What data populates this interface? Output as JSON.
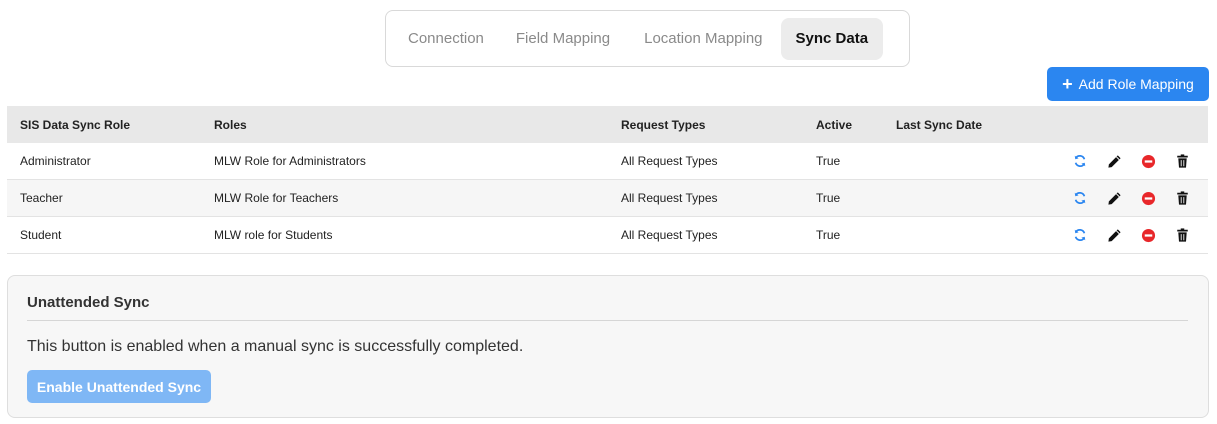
{
  "tabs": [
    {
      "label": "Connection",
      "active": false
    },
    {
      "label": "Field Mapping",
      "active": false
    },
    {
      "label": "Location Mapping",
      "active": false
    },
    {
      "label": "Sync Data",
      "active": true
    }
  ],
  "toolbar": {
    "add_role_mapping_label": "Add Role Mapping"
  },
  "table": {
    "headers": [
      "SIS Data Sync Role",
      "Roles",
      "Request Types",
      "Active",
      "Last Sync Date"
    ],
    "rows": [
      {
        "sis_role": "Administrator",
        "roles": "MLW Role for Administrators",
        "request_types": "All Request Types",
        "active": "True",
        "last_sync": ""
      },
      {
        "sis_role": "Teacher",
        "roles": "MLW Role for Teachers",
        "request_types": "All Request Types",
        "active": "True",
        "last_sync": ""
      },
      {
        "sis_role": "Student",
        "roles": "MLW role for Students",
        "request_types": "All Request Types",
        "active": "True",
        "last_sync": ""
      }
    ],
    "row_action_icons": [
      "sync-icon",
      "pencil-icon",
      "minus-circle-icon",
      "trash-icon"
    ]
  },
  "unattended": {
    "title": "Unattended Sync",
    "description": "This button is enabled when a manual sync is successfully completed.",
    "button_label": "Enable Unattended Sync"
  },
  "colors": {
    "accent": "#2b86f0",
    "accent_disabled": "#7fb7f5",
    "danger": "#e8272a",
    "sync": "#2b86f0"
  }
}
